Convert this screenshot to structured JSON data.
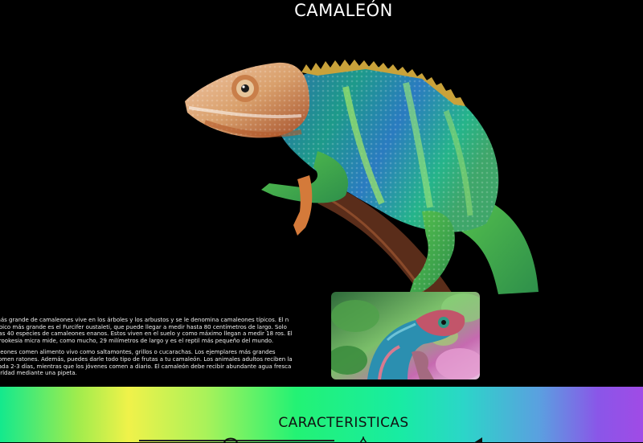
{
  "hero": {
    "title": "CAMALEÓN"
  },
  "article": {
    "paragraph_1": "más grande de camaleones vive en los árboles y los arbustos y se le denomina camaleones típicos. El n típico más grande es el Furcifer oustaleti, que puede llegar a medir hasta 80 centímetros de largo. Solo nas 40 especies de camaleones enanos. Estos viven en el suelo y como máximo llegan a medir 18 ros. El Brookesia micra mide, como mucho, 29 milímetros de largo y es el reptil más pequeño del mundo.",
    "paragraph_2": "aleones comen alimento vivo como saltamontes, grillos o cucarachas. Los ejemplares más grandes comen ratones. Además, puedes darle todo tipo de frutas a tu camaleón. Los animales adultos reciben la cada 2-3 días, mientras que los jóvenes comen a diario. El camaleón debe recibir abundante agua fresca larldad mediante una pipeta."
  },
  "features": {
    "title": "CARACTERISTICAS"
  },
  "icons": {
    "hero": "chameleon-illustration-icon",
    "photo": "chameleon-photo-icon"
  },
  "colors": {
    "background": "#000000",
    "text": "#ffffff",
    "band_title": "#111111"
  }
}
